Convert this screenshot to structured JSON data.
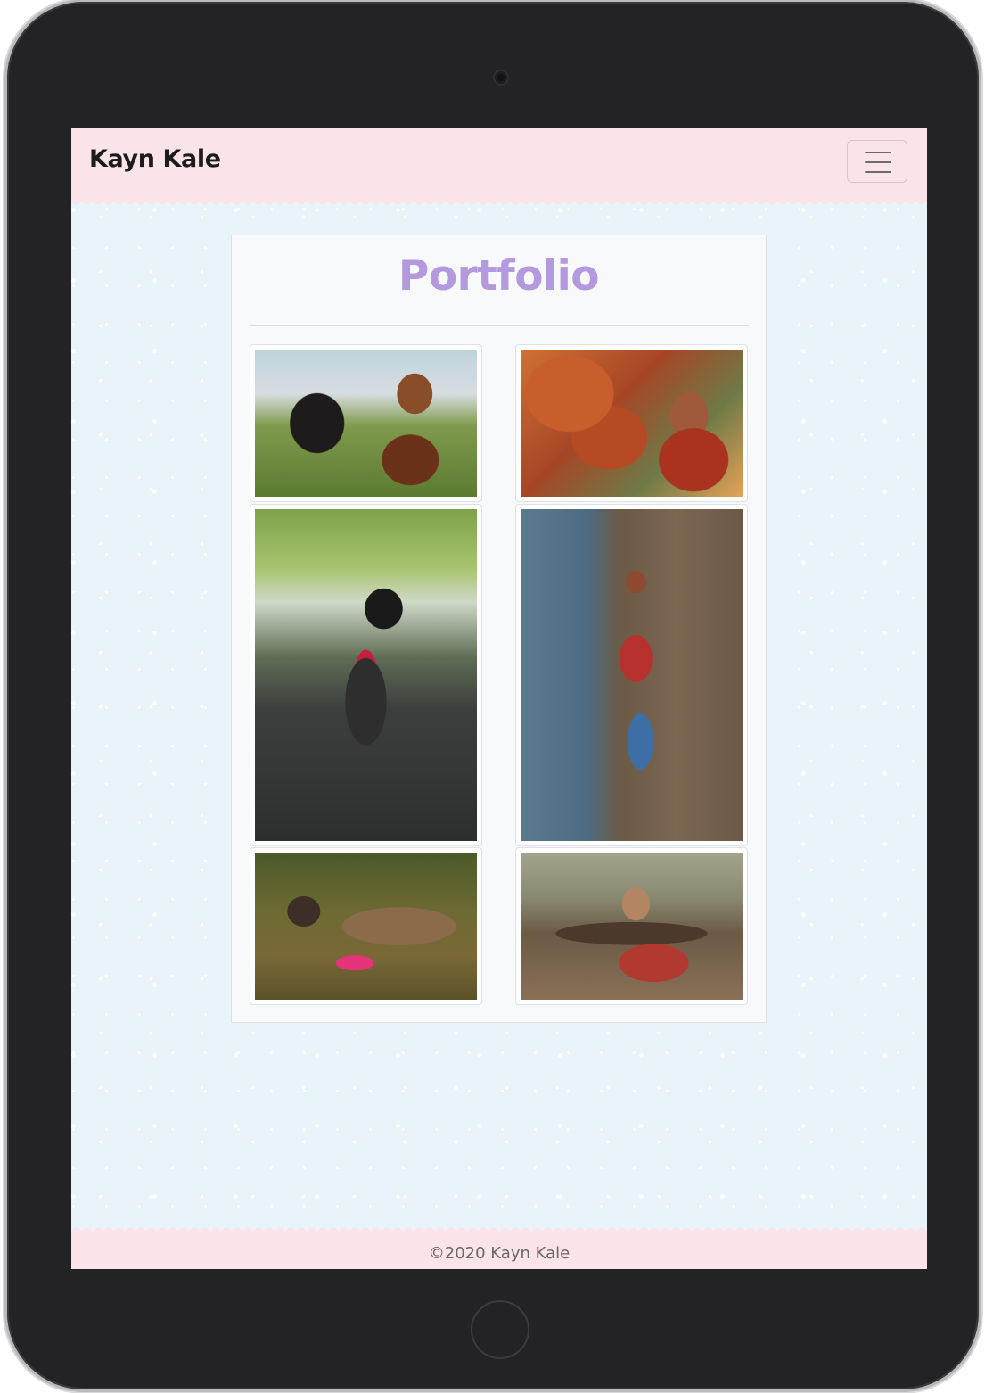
{
  "navbar": {
    "brand": "Kayn Kale",
    "toggler_icon": "hamburger-menu-icon",
    "background": "#fbe3ea"
  },
  "main": {
    "title": "Portfolio",
    "title_color": "#b399dd",
    "photos": [
      {
        "subject": "young man with black and white poodle"
      },
      {
        "subject": "woman reaching for autumn leaves"
      },
      {
        "subject": "black and white poodle on path"
      },
      {
        "subject": "woman in red cardigan by creek"
      },
      {
        "subject": "ferret on grass with pink harness"
      },
      {
        "subject": "woman leaning on log"
      }
    ]
  },
  "footer": {
    "text": "©2020 Kayn Kale"
  },
  "colors": {
    "page_background": "#e9f3fa",
    "accent_pink": "#fbe3ea",
    "card_background": "#f8f9fa"
  }
}
